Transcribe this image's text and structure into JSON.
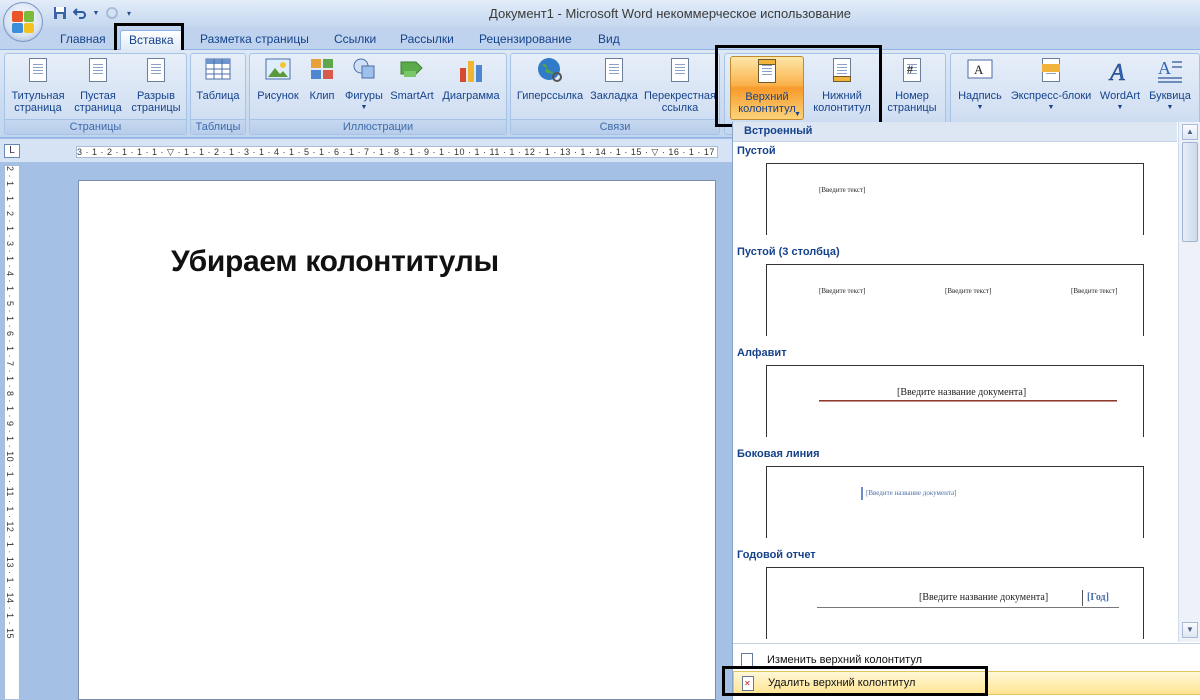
{
  "window": {
    "title": "Документ1 - Microsoft Word некоммерческое использование"
  },
  "tabs": [
    {
      "label": "Главная"
    },
    {
      "label": "Вставка"
    },
    {
      "label": "Разметка страницы"
    },
    {
      "label": "Ссылки"
    },
    {
      "label": "Рассылки"
    },
    {
      "label": "Рецензирование"
    },
    {
      "label": "Вид"
    }
  ],
  "ribbon": {
    "groups": {
      "pages": {
        "label": "Страницы",
        "title_page": "Титульная\nстраница",
        "blank_page": "Пустая\nстраница",
        "page_break": "Разрыв\nстраницы"
      },
      "tables": {
        "label": "Таблицы",
        "table": "Таблица"
      },
      "illustrations": {
        "label": "Иллюстрации",
        "picture": "Рисунок",
        "clip": "Клип",
        "shapes": "Фигуры",
        "smartart": "SmartArt",
        "chart": "Диаграмма"
      },
      "links": {
        "label": "Связи",
        "hyperlink": "Гиперссылка",
        "bookmark": "Закладка",
        "cross_ref_1": "Перекрестная",
        "cross_ref_2": "ссылка"
      },
      "header_footer": {
        "header_1": "Верхний",
        "header_2": "колонтитул",
        "footer_1": "Нижний",
        "footer_2": "колонтитул",
        "page_num_1": "Номер",
        "page_num_2": "страницы"
      },
      "text": {
        "textbox": "Надпись",
        "quickparts": "Экспресс-блоки",
        "wordart": "WordArt",
        "dropcap": "Буквица"
      }
    }
  },
  "ruler": {
    "horizontal": "3 · 1 · 2 · 1 · 1 · 1 · ▽ · 1 · 1 · 2 · 1 · 3 · 1 · 4 · 1 · 5 · 1 · 6 · 1 · 7 · 1 · 8 · 1 · 9 · 1 · 10 · 1 · 11 · 1 · 12 · 1 · 13 · 1 · 14 · 1 · 15 · ▽ · 16 · 1 · 17 · 1",
    "vertical": "2 · 1 · 1 · 2 · 1 · 3 · 1 · 4 · 1 · 5 · 1 · 6 · 1 · 7 · 1 · 8 · 1 · 9 · 1 · 10 · 1 · 11 · 1 · 12 · 1 · 13 · 1 · 14 · 1 · 15",
    "corner": "L"
  },
  "document": {
    "heading": "Убираем колонтитулы"
  },
  "gallery": {
    "section": "Встроенный",
    "items": [
      {
        "name": "Пустой",
        "placeholders": [
          "[Введите текст]"
        ]
      },
      {
        "name": "Пустой (3 столбца)",
        "placeholders": [
          "[Введите текст]",
          "[Введите текст]",
          "[Введите текст]"
        ]
      },
      {
        "name": "Алфавит",
        "placeholders": [
          "[Введите название документа]"
        ]
      },
      {
        "name": "Боковая линия",
        "placeholders": [
          "[Введите название документа]"
        ]
      },
      {
        "name": "Годовой отчет",
        "placeholders": [
          "[Введите название документа]",
          "[Год]"
        ]
      }
    ],
    "menu": {
      "edit_header": "Изменить верхний колонтитул",
      "remove_header": "Удалить верхний колонтитул"
    }
  },
  "colors": {
    "accent_orange": "#f89a2b",
    "ribbon_blue": "#c9daf0",
    "title_blue": "#15428b"
  }
}
